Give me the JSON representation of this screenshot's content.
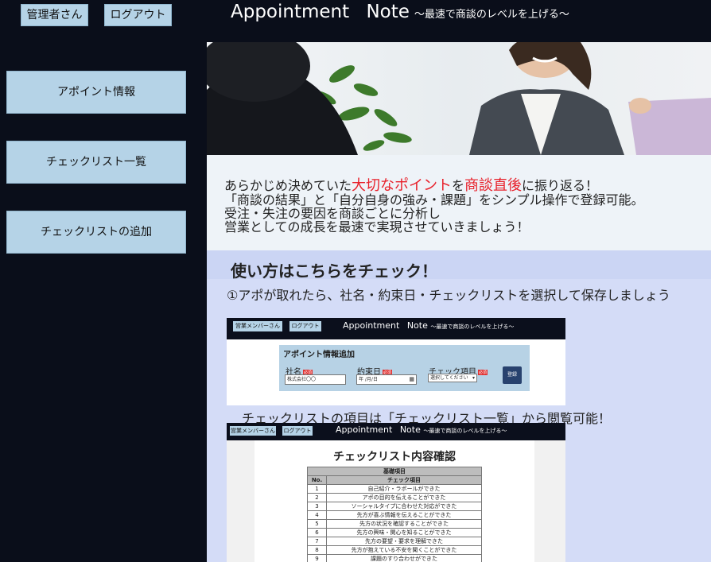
{
  "header": {
    "user_label": "管理者さん",
    "logout_label": "ログアウト",
    "app_title": "Appointment Note",
    "app_subtitle": "〜最速で商談のレベルを上げる〜"
  },
  "sidebar": {
    "items": [
      {
        "label": "アポイント情報"
      },
      {
        "label": "チェックリスト一覧"
      },
      {
        "label": "チェックリストの追加"
      }
    ]
  },
  "intro": {
    "line1_a": "あらかじめ決めていた",
    "line1_hl1": "大切なポイント",
    "line1_b": "を",
    "line1_hl2": "商談直後",
    "line1_c": "に振り返る！",
    "line2": "「商談の結果」と「自分自身の強み・課題」をシンプル操作で登録可能。",
    "line3": "受注・失注の要因を商談ごとに分析し",
    "line4": "営業としての成長を最速で実現させていきましょう！"
  },
  "howto": {
    "heading": "使い方はこちらをチェック！",
    "step1": "①アポが取れたら、社名・約束日・チェックリストを選択して保存しましょう",
    "step2": "チェックリストの項目は「チェックリスト一覧」から閲覧可能！"
  },
  "shot1": {
    "user_label": "営業メンバーさん",
    "logout_label": "ログアウト",
    "app_title": "Appointment Note",
    "app_subtitle": "〜最速で商談のレベルを上げる〜",
    "form_title": "アポイント情報追加",
    "company_label": "社名",
    "date_label": "約束日",
    "check_label": "チェック項目",
    "required_badge": "必須",
    "company_value": "株式会社〇〇",
    "date_value": "年 /月/日",
    "check_value": "選択してください",
    "register_label": "登録"
  },
  "shot2": {
    "user_label": "営業メンバーさん",
    "logout_label": "ログアウト",
    "app_title": "Appointment Note",
    "app_subtitle": "〜最速で商談のレベルを上げる〜",
    "doc_title": "チェックリスト内容確認",
    "section_header": "基礎項目",
    "col_no": "No.",
    "col_item": "チェック項目",
    "rows": [
      {
        "no": "1",
        "item": "自己紹介・ラポールができた"
      },
      {
        "no": "2",
        "item": "アポの目的を伝えることができた"
      },
      {
        "no": "3",
        "item": "ソーシャルタイプに合わせた対応ができた"
      },
      {
        "no": "4",
        "item": "先方が喜ぶ情報を伝えることができた"
      },
      {
        "no": "5",
        "item": "先方の状況を確認することができた"
      },
      {
        "no": "6",
        "item": "先方の興味・関心を知ることができた"
      },
      {
        "no": "7",
        "item": "先方の要望・要求を理解できた"
      },
      {
        "no": "8",
        "item": "先方が抱えている不安を聞くことができた"
      },
      {
        "no": "9",
        "item": "課題のすり合わせができた"
      }
    ]
  },
  "colors": {
    "background": "#0a0e1a",
    "button": "#b5d3e7",
    "highlight": "#e8202a",
    "main_panel": "#d4dcf7"
  }
}
